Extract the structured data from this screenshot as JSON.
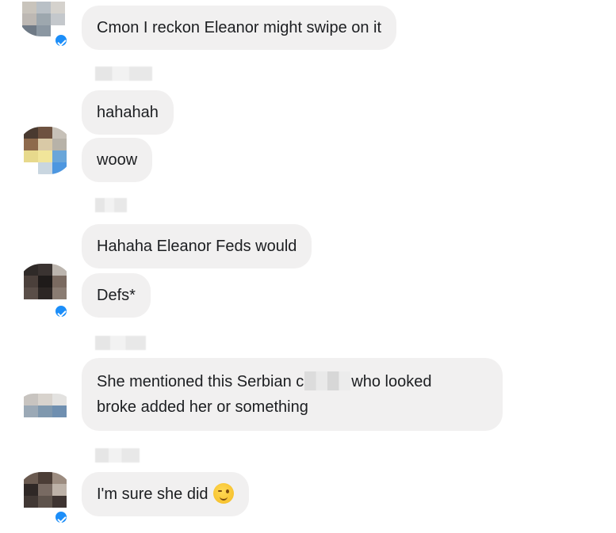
{
  "conversation": {
    "messages": [
      {
        "text": "Cmon I reckon Eleanor might swipe on it"
      },
      {
        "text": "hahahah"
      },
      {
        "text": "woow"
      },
      {
        "text": "Hahaha Eleanor Feds would"
      },
      {
        "text": "Defs*"
      },
      {
        "text_before": "She mentioned this Serbian c",
        "text_after": "who looked",
        "text_line2": "broke added her or something"
      },
      {
        "text": "I'm sure she did",
        "emoji": "winking-face-emoji"
      }
    ]
  },
  "icons": {
    "verified_badge": "messenger-badge-icon",
    "emoji": "winking-face-emoji"
  },
  "colors": {
    "bubble": "#f1f0f0",
    "text": "#1c1e21",
    "badge": "#1c8ef9"
  }
}
